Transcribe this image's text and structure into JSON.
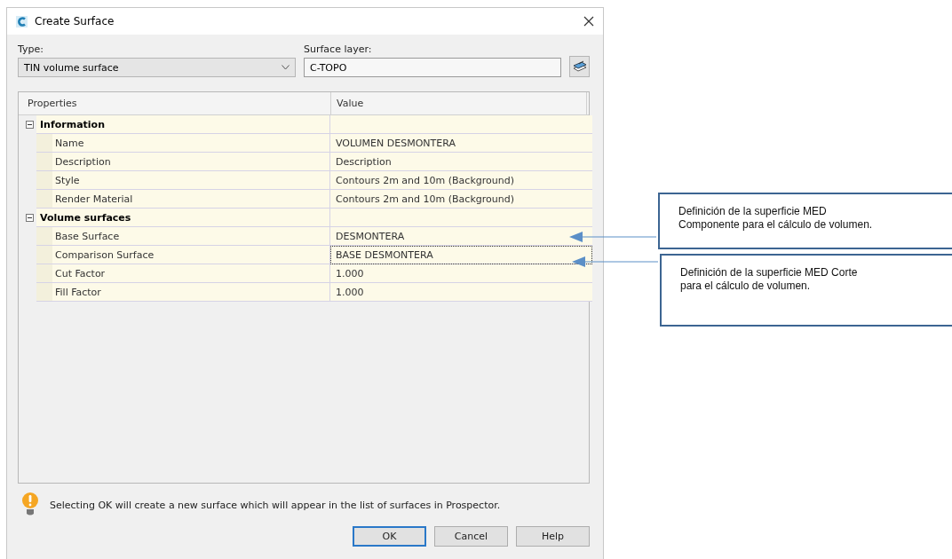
{
  "window": {
    "title": "Create Surface"
  },
  "type_field": {
    "label": "Type:",
    "value": "TIN volume surface"
  },
  "surface_layer": {
    "label": "Surface layer:",
    "value": "C-TOPO"
  },
  "properties": {
    "columns": [
      "Properties",
      "Value"
    ],
    "groups": [
      {
        "name": "Information",
        "expanded": true,
        "rows": [
          {
            "property": "Name",
            "value": "VOLUMEN DESMONTERA",
            "selected": false
          },
          {
            "property": "Description",
            "value": "Description",
            "selected": false
          },
          {
            "property": "Style",
            "value": "Contours 2m and 10m (Background)",
            "selected": false
          },
          {
            "property": "Render Material",
            "value": "Contours 2m and 10m (Background)",
            "selected": false
          }
        ]
      },
      {
        "name": "Volume surfaces",
        "expanded": true,
        "rows": [
          {
            "property": "Base Surface",
            "value": "DESMONTERA",
            "selected": false
          },
          {
            "property": "Comparison Surface",
            "value": "BASE DESMONTERA",
            "selected": true
          },
          {
            "property": "Cut Factor",
            "value": "1.000",
            "selected": false
          },
          {
            "property": "Fill Factor",
            "value": "1.000",
            "selected": false
          }
        ]
      }
    ]
  },
  "message": "Selecting OK will create a new surface which will appear in the list of surfaces in Prospector.",
  "buttons": [
    {
      "label": "OK",
      "default": true
    },
    {
      "label": "Cancel",
      "default": false
    },
    {
      "label": "Help",
      "default": false
    }
  ],
  "annotations": [
    {
      "text": "Definición de la superficie MED\nComponente para el cálculo de volumen."
    },
    {
      "text": "Definición de la superficie MED Corte\npara el cálculo de volumen."
    }
  ]
}
